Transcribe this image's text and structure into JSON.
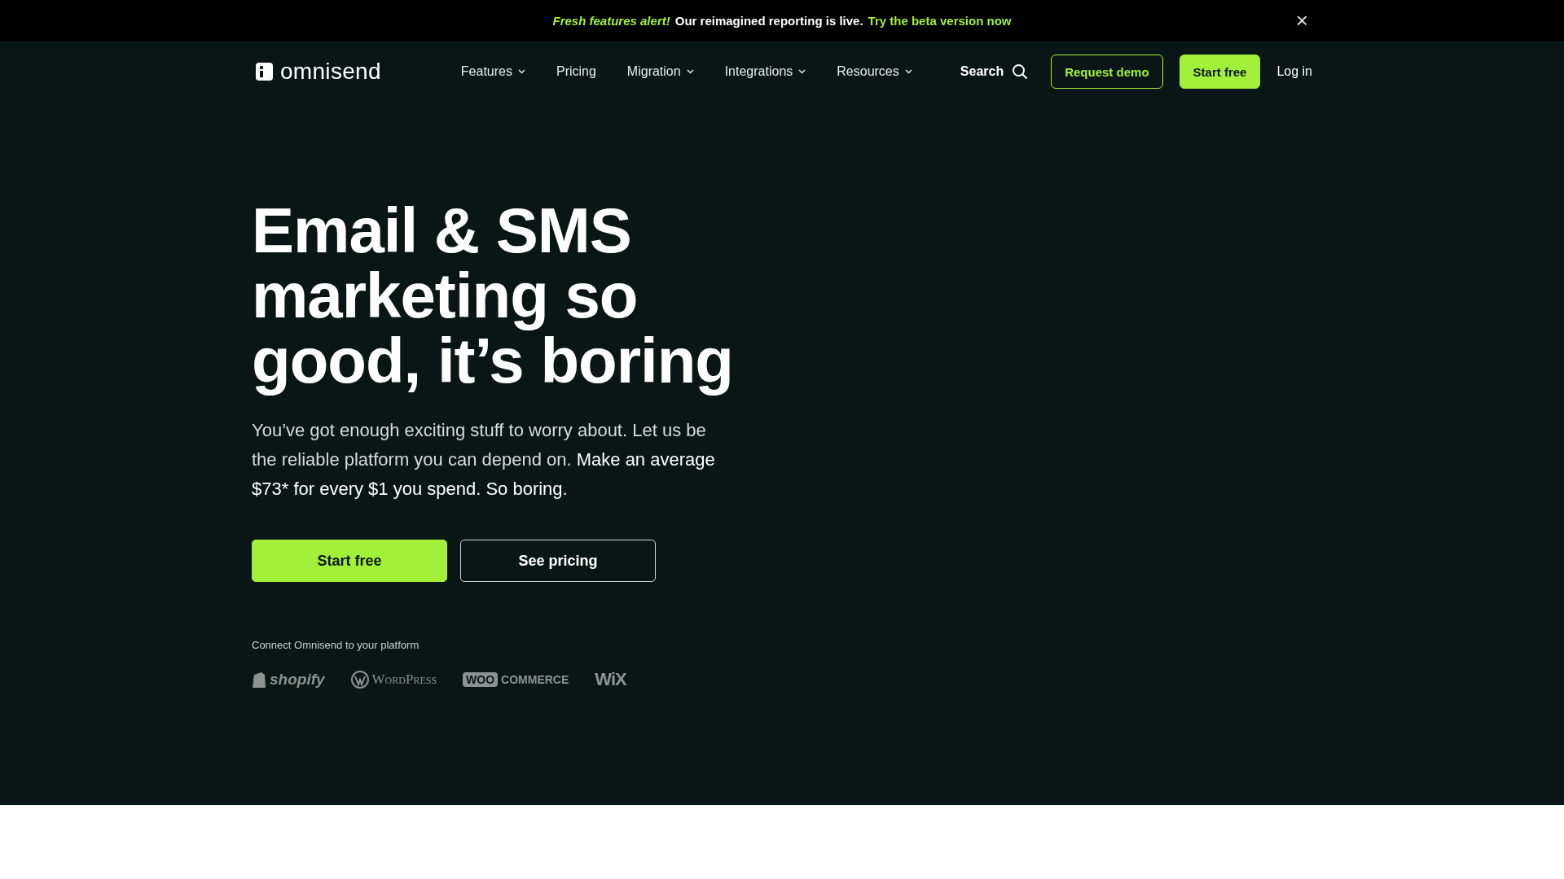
{
  "announcement": {
    "highlight": "Fresh features alert!",
    "message": "Our reimagined reporting is live.",
    "link": "Try the beta version now",
    "close": "×"
  },
  "nav": {
    "logo": "omnisend",
    "items": [
      {
        "label": "Features",
        "dropdown": true
      },
      {
        "label": "Pricing",
        "dropdown": false
      },
      {
        "label": "Migration",
        "dropdown": true
      },
      {
        "label": "Integrations",
        "dropdown": true
      },
      {
        "label": "Resources",
        "dropdown": true
      }
    ],
    "search": "Search",
    "request_demo": "Request demo",
    "start_free": "Start free",
    "login": "Log in"
  },
  "hero": {
    "heading": [
      "Email & SMS",
      "marketing so",
      "good, it’s boring"
    ],
    "subtext": "You’ve got enough exciting stuff to worry about. Let us be the reliable platform you can depend on. **Make an average $73* for every $1 you spend. So boring.**",
    "primary_button": "Start free",
    "secondary_button": "See pricing",
    "platforms_label": "Connect Omnisend to your platform",
    "platforms": [
      {
        "kind": "shopify",
        "name": "shopify"
      },
      {
        "kind": "wordpress",
        "name": "WordPress"
      },
      {
        "kind": "woocommerce",
        "name": "COMMERCE",
        "badge": "WOO"
      },
      {
        "kind": "wix",
        "name": "WiX"
      }
    ]
  }
}
